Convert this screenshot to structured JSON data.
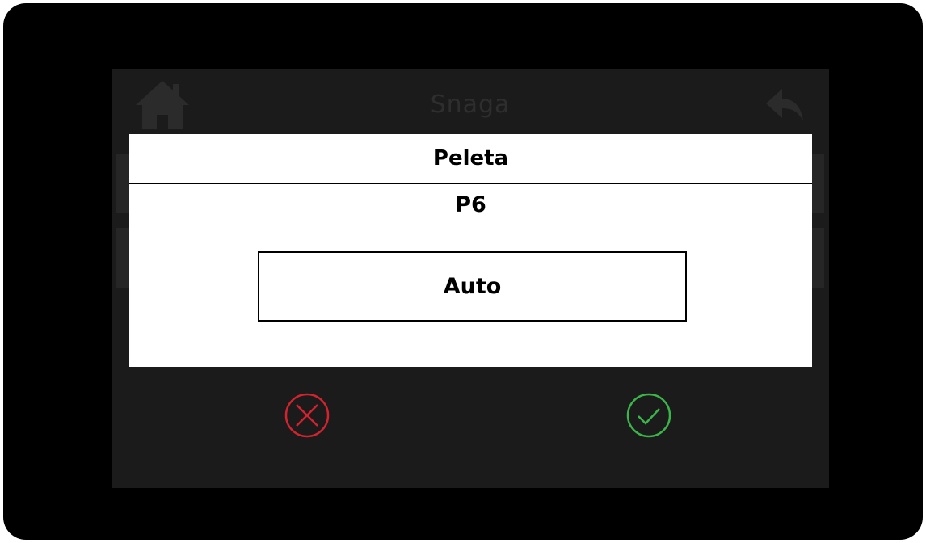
{
  "background_screen": {
    "title": "Snaga",
    "home_icon": "home-icon",
    "back_icon": "back-arrow-icon"
  },
  "dialog": {
    "title": "Peleta",
    "value": "P6",
    "option_label": "Auto"
  },
  "actions": {
    "cancel_icon": "cancel-circle-x-icon",
    "confirm_icon": "confirm-circle-check-icon",
    "cancel_color": "#d3232f",
    "confirm_color": "#3bb54a"
  },
  "colors": {
    "device_frame": "#000000",
    "screen_background": "#1b1b1b",
    "dialog_background": "#ffffff"
  }
}
